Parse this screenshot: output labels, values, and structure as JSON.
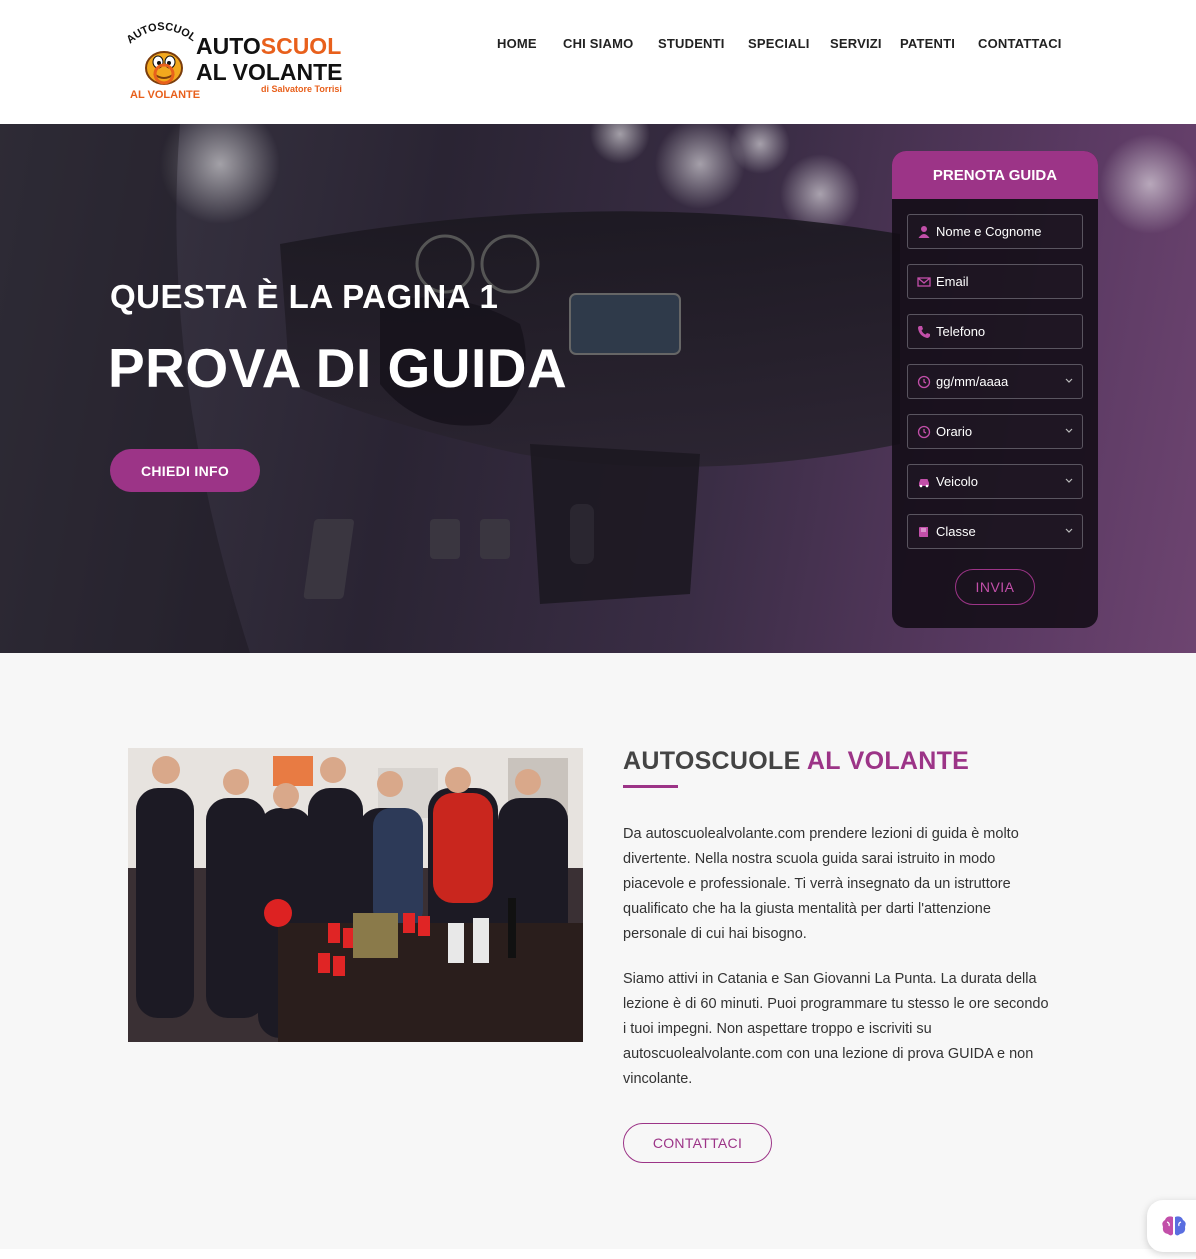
{
  "logo": {
    "arc_text": "AUTOSCUOLE",
    "bottom_text": "AL VOLANTE",
    "line1_a": "AUTO",
    "line1_b": "SCUOLE",
    "line2": "AL VOLANTE",
    "byline": "di Salvatore Torrisi"
  },
  "nav": {
    "items": [
      {
        "label": "HOME"
      },
      {
        "label": "CHI SIAMO"
      },
      {
        "label": "STUDENTI"
      },
      {
        "label": "SPECIALI"
      },
      {
        "label": "SERVIZI"
      },
      {
        "label": "PATENTI"
      },
      {
        "label": "CONTATTACI"
      }
    ]
  },
  "hero": {
    "subtitle": "QUESTA È LA PAGINA 1",
    "title": "PROVA DI GUIDA",
    "button": "CHIEDI INFO"
  },
  "booking": {
    "title": "PRENOTA GUIDA",
    "fields": [
      {
        "placeholder": "Nome e Cognome",
        "icon": "user-icon"
      },
      {
        "placeholder": "Email",
        "icon": "envelope-icon"
      },
      {
        "placeholder": "Telefono",
        "icon": "phone-icon"
      },
      {
        "placeholder": "gg/mm/aaaa",
        "icon": "clock-icon"
      },
      {
        "placeholder": "Orario",
        "icon": "clock-icon"
      },
      {
        "placeholder": "Veicolo",
        "icon": "car-icon"
      },
      {
        "placeholder": "Classe",
        "icon": "book-icon"
      }
    ],
    "submit": "INVIA"
  },
  "about": {
    "title_a": "AUTOSCUOLE",
    "title_b": "AL VOLANTE",
    "paragraph1": "Da autoscuolealvolante.com prendere lezioni di guida è molto divertente. Nella nostra scuola guida sarai istruito in modo piacevole e professionale. Ti verrà insegnato da un istruttore qualificato che ha la giusta mentalità per darti l'attenzione personale di cui hai bisogno.",
    "paragraph2": "Siamo attivi in Catania e San Giovanni La Punta. La durata della lezione è di 60 minuti. Puoi programmare tu stesso le ore secondo i tuoi impegni. Non aspettare troppo e iscriviti su autoscuolealvolante.com con una lezione di prova GUIDA e non vincolante.",
    "button": "CONTATTACI"
  },
  "colors": {
    "accent": "#9c3487",
    "logo_orange": "#e8601c"
  }
}
